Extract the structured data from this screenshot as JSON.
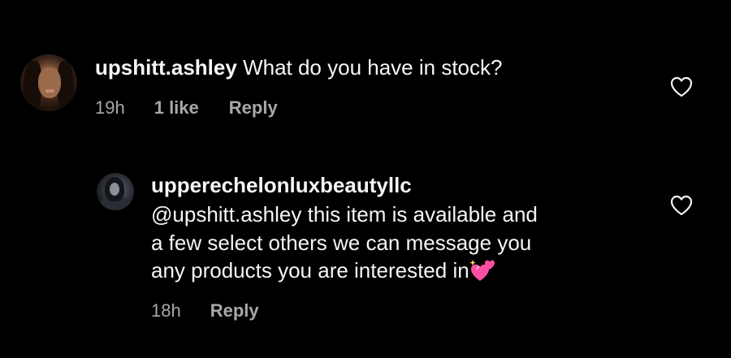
{
  "comments": [
    {
      "username": "upshitt.ashley",
      "text": "What do you have in stock?",
      "time": "19h",
      "likes": "1 like",
      "reply_label": "Reply",
      "avatar": "profile-photo-woman"
    },
    {
      "username": "upperechelonluxbeautyllc",
      "mention": "@upshitt.ashley",
      "lines": [
        " this item is available and",
        "a few select others we can message you",
        "any products you are interested in"
      ],
      "emoji": "two-hearts-emoji",
      "time": "18h",
      "reply_label": "Reply",
      "avatar": "profile-photo-hooded-figure"
    }
  ],
  "icons": {
    "like": "heart-outline-icon"
  },
  "colors": {
    "background": "#000000",
    "text": "#f5f5f5",
    "meta_text": "#a8a8a8",
    "emoji_pink": "#ff4fa3"
  }
}
